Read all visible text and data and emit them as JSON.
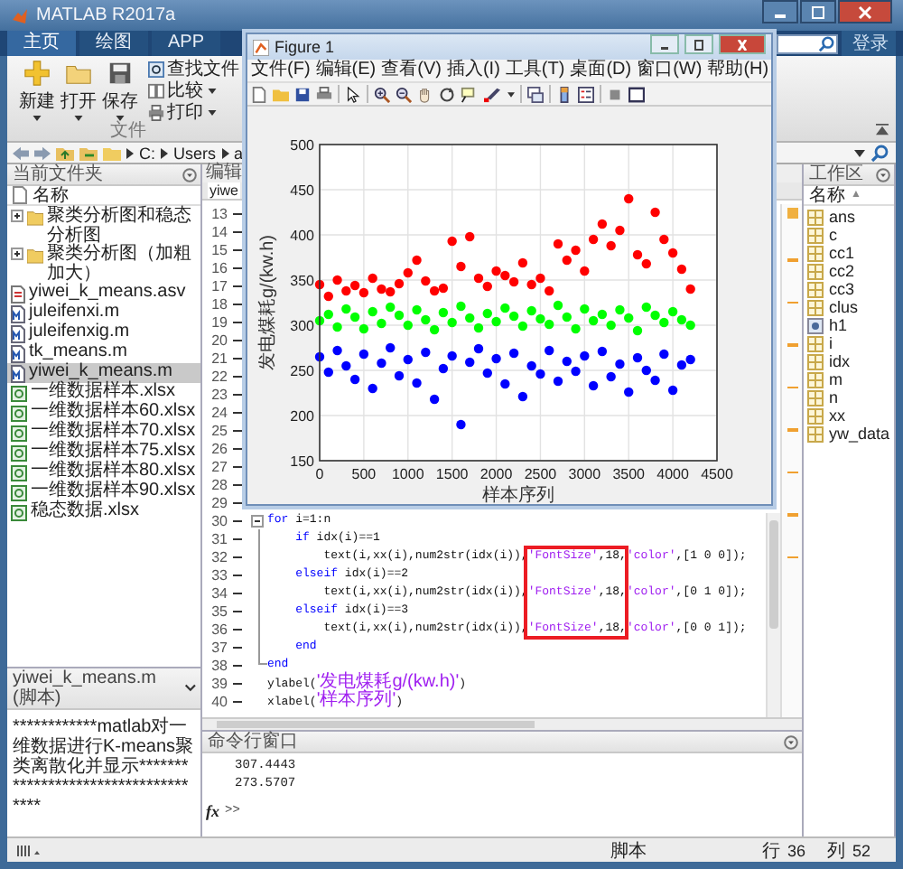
{
  "window": {
    "title": "MATLAB R2017a"
  },
  "tabs": [
    {
      "label": "主页",
      "selected": true
    },
    {
      "label": "绘图",
      "selected": false
    },
    {
      "label": "APP",
      "selected": false
    }
  ],
  "account": {
    "label": "登录"
  },
  "ribbon": {
    "large_buttons": [
      "新建",
      "打开",
      "保存"
    ],
    "small_buttons": [
      "查找文件",
      "比较",
      "打印"
    ],
    "group_label": "文件"
  },
  "address_bar": {
    "path": [
      "C:",
      "Users",
      "a"
    ]
  },
  "current_folder": {
    "title": "当前文件夹",
    "column": "名称",
    "items": [
      {
        "name": "聚类分析图和稳态分析图",
        "kind": "folder",
        "expanded": false,
        "selected": false
      },
      {
        "name": "聚类分析图（加粗加大）",
        "kind": "folder",
        "expanded": false,
        "selected": false
      },
      {
        "name": "yiwei_k_means.asv",
        "kind": "asv",
        "selected": false
      },
      {
        "name": "juleifenxi.m",
        "kind": "m",
        "selected": false
      },
      {
        "name": "juleifenxig.m",
        "kind": "m",
        "selected": false
      },
      {
        "name": "tk_means.m",
        "kind": "m",
        "selected": false
      },
      {
        "name": "yiwei_k_means.m",
        "kind": "m",
        "selected": true
      },
      {
        "name": "一维数据样本.xlsx",
        "kind": "xlsx",
        "selected": false
      },
      {
        "name": "一维数据样本60.xlsx",
        "kind": "xlsx",
        "selected": false
      },
      {
        "name": "一维数据样本70.xlsx",
        "kind": "xlsx",
        "selected": false
      },
      {
        "name": "一维数据样本75.xlsx",
        "kind": "xlsx",
        "selected": false
      },
      {
        "name": "一维数据样本80.xlsx",
        "kind": "xlsx",
        "selected": false
      },
      {
        "name": "一维数据样本90.xlsx",
        "kind": "xlsx",
        "selected": false
      },
      {
        "name": "稳态数据.xlsx",
        "kind": "xlsx",
        "selected": false
      }
    ]
  },
  "details": {
    "title": "yiwei_k_means.m (脚本)",
    "text": "************matlab对一维数据进行K-means聚类离散化并显示************************************"
  },
  "editor": {
    "title": "编辑",
    "tab": "yiwe",
    "lines": [
      {
        "number": "13"
      },
      {
        "number": "14"
      },
      {
        "number": "15"
      },
      {
        "number": "16"
      },
      {
        "number": "17"
      },
      {
        "number": "18"
      },
      {
        "number": "19"
      },
      {
        "number": "20"
      },
      {
        "number": "21"
      },
      {
        "number": "22"
      },
      {
        "number": "23"
      },
      {
        "number": "24"
      },
      {
        "number": "25"
      },
      {
        "number": "26"
      },
      {
        "number": "27"
      },
      {
        "number": "28"
      },
      {
        "number": "29"
      },
      {
        "number": "30",
        "kind": "fold-start",
        "segments": [
          {
            "kind": "kw",
            "text": "for"
          },
          {
            "kind": "plain",
            "text": " i=1:n"
          }
        ]
      },
      {
        "number": "31",
        "kind": "fold-inside",
        "segments": [
          {
            "kind": "kw",
            "text": "    if"
          },
          {
            "kind": "plain",
            "text": " idx(i)==1"
          }
        ]
      },
      {
        "number": "32",
        "kind": "fold-inside",
        "segments": [
          {
            "kind": "plain",
            "text": "        text(i,xx(i),num2str(idx(i)),"
          },
          {
            "kind": "box",
            "parts": [
              {
                "kind": "str",
                "text": "'FontSize'"
              },
              {
                "kind": "plain",
                "text": ",18,"
              }
            ]
          },
          {
            "kind": "str",
            "text": "'color'"
          },
          {
            "kind": "plain",
            "text": ",[1 0 0]);"
          }
        ]
      },
      {
        "number": "33",
        "kind": "fold-inside",
        "segments": [
          {
            "kind": "kw",
            "text": "    elseif"
          },
          {
            "kind": "plain",
            "text": " idx(i)==2"
          }
        ]
      },
      {
        "number": "34",
        "kind": "fold-inside",
        "segments": [
          {
            "kind": "plain",
            "text": "        text(i,xx(i),num2str(idx(i)),"
          },
          {
            "kind": "box",
            "parts": [
              {
                "kind": "str",
                "text": "'FontSize'"
              },
              {
                "kind": "plain",
                "text": ",18,"
              }
            ]
          },
          {
            "kind": "str",
            "text": "'color'"
          },
          {
            "kind": "plain",
            "text": ",[0 1 0]);"
          }
        ]
      },
      {
        "number": "35",
        "kind": "fold-inside",
        "segments": [
          {
            "kind": "kw",
            "text": "    elseif"
          },
          {
            "kind": "plain",
            "text": " idx(i)==3"
          }
        ]
      },
      {
        "number": "36",
        "kind": "fold-inside",
        "segments": [
          {
            "kind": "plain",
            "text": "        text(i,xx(i),num2str(idx(i)),"
          },
          {
            "kind": "box",
            "parts": [
              {
                "kind": "str",
                "text": "'FontSize'"
              },
              {
                "kind": "plain",
                "text": ",18,"
              }
            ]
          },
          {
            "kind": "str",
            "text": "'color'"
          },
          {
            "kind": "plain",
            "text": ",[0 0 1]);"
          }
        ]
      },
      {
        "number": "37",
        "kind": "fold-inside",
        "segments": [
          {
            "kind": "kw",
            "text": "    end"
          }
        ]
      },
      {
        "number": "38",
        "kind": "fold-end",
        "segments": [
          {
            "kind": "kw",
            "text": "end"
          }
        ]
      },
      {
        "number": "39",
        "segments": [
          {
            "kind": "plain",
            "text": "ylabel("
          },
          {
            "kind": "str",
            "text": "'发电煤耗g/(kw.h)'"
          },
          {
            "kind": "plain",
            "text": ")"
          }
        ]
      },
      {
        "number": "40",
        "segments": [
          {
            "kind": "plain",
            "text": "xlabel("
          },
          {
            "kind": "str",
            "text": "'样本序列'"
          },
          {
            "kind": "plain",
            "text": ")"
          }
        ]
      }
    ]
  },
  "command_window": {
    "title": "命令行窗口",
    "output": [
      "307.4443",
      "273.5707"
    ],
    "fx": "fx",
    "prompt": ">>"
  },
  "workspace": {
    "title": "工作区",
    "column": "名称",
    "sort_indicator": "▲",
    "variables": [
      {
        "name": "ans",
        "kind": "array"
      },
      {
        "name": "c",
        "kind": "array"
      },
      {
        "name": "cc1",
        "kind": "array"
      },
      {
        "name": "cc2",
        "kind": "array"
      },
      {
        "name": "cc3",
        "kind": "array"
      },
      {
        "name": "clus",
        "kind": "array"
      },
      {
        "name": "h1",
        "kind": "handle"
      },
      {
        "name": "i",
        "kind": "array"
      },
      {
        "name": "idx",
        "kind": "array"
      },
      {
        "name": "m",
        "kind": "array"
      },
      {
        "name": "n",
        "kind": "array"
      },
      {
        "name": "xx",
        "kind": "array"
      },
      {
        "name": "yw_data",
        "kind": "array"
      }
    ]
  },
  "status_bar": {
    "mode": "脚本",
    "line_label": "行",
    "line": "36",
    "column_label": "列",
    "column": "52"
  },
  "figure": {
    "title": "Figure 1",
    "menu": [
      "文件(F)",
      "编辑(E)",
      "查看(V)",
      "插入(I)",
      "工具(T)",
      "桌面(D)",
      "窗口(W)",
      "帮助(H)"
    ],
    "chart_data": {
      "type": "scatter",
      "xlabel": "样本序列",
      "ylabel": "发电煤耗g/(kw.h)",
      "x": [
        0,
        100,
        200,
        300,
        400,
        500,
        600,
        700,
        800,
        900,
        1000,
        1100,
        1200,
        1300,
        1400,
        1500,
        1600,
        1700,
        1800,
        1900,
        2000,
        2100,
        2200,
        2300,
        2400,
        2500,
        2600,
        2700,
        2800,
        2900,
        3000,
        3100,
        3200,
        3300,
        3400,
        3500,
        3600,
        3700,
        3800,
        3900,
        4000,
        4100,
        4200
      ],
      "series": [
        {
          "color": "#ff0000",
          "values": [
            345,
            332,
            350,
            338,
            344,
            336,
            352,
            340,
            337,
            346,
            358,
            372,
            349,
            338,
            341,
            393,
            365,
            398,
            352,
            343,
            360,
            355,
            348,
            369,
            345,
            352,
            338,
            390,
            372,
            383,
            360,
            395,
            412,
            388,
            405,
            440,
            378,
            368,
            425,
            395,
            380,
            362,
            340
          ]
        },
        {
          "color": "#00ff00",
          "values": [
            305,
            312,
            298,
            318,
            309,
            296,
            315,
            302,
            320,
            311,
            300,
            317,
            306,
            295,
            314,
            303,
            321,
            308,
            297,
            313,
            304,
            319,
            310,
            299,
            316,
            307,
            301,
            322,
            309,
            296,
            318,
            305,
            312,
            300,
            317,
            308,
            294,
            320,
            311,
            303,
            315,
            306,
            300
          ]
        },
        {
          "color": "#0000ff",
          "values": [
            265,
            248,
            272,
            255,
            240,
            268,
            230,
            258,
            275,
            244,
            262,
            236,
            270,
            218,
            252,
            266,
            190,
            259,
            274,
            247,
            263,
            235,
            269,
            221,
            255,
            246,
            272,
            238,
            260,
            249,
            266,
            233,
            271,
            243,
            257,
            226,
            264,
            250,
            239,
            268,
            228,
            256,
            262
          ]
        }
      ],
      "xlim": [
        0,
        4500
      ],
      "ylim": [
        150,
        500
      ],
      "grid": true,
      "xticks": [
        0,
        500,
        1000,
        1500,
        2000,
        2500,
        3000,
        3500,
        4000,
        4500
      ],
      "yticks": [
        150,
        200,
        250,
        300,
        350,
        400,
        450,
        500
      ]
    }
  }
}
